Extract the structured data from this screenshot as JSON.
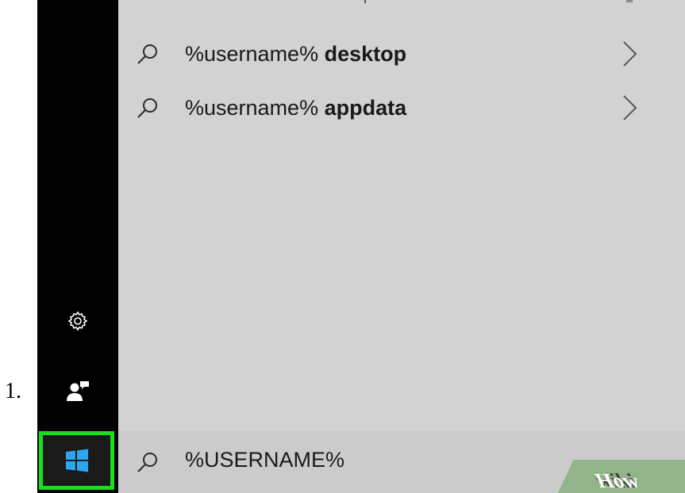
{
  "step_label": "1.",
  "search_results": [
    {
      "prefix": "%username% ",
      "suffix": "desktop"
    },
    {
      "prefix": "%username% ",
      "suffix": "appdata"
    }
  ],
  "search_box": {
    "query": "%USERNAME%"
  },
  "icons": {
    "settings": "gear-icon",
    "account": "person-icon",
    "start": "windows-logo-icon",
    "search": "search-icon",
    "chevron": "chevron-right-icon"
  },
  "colors": {
    "start_highlight": "#18e018",
    "taskbar": "#000000",
    "panel": "#d2d2d2"
  },
  "watermark": {
    "left": "wiki",
    "right": "How"
  }
}
